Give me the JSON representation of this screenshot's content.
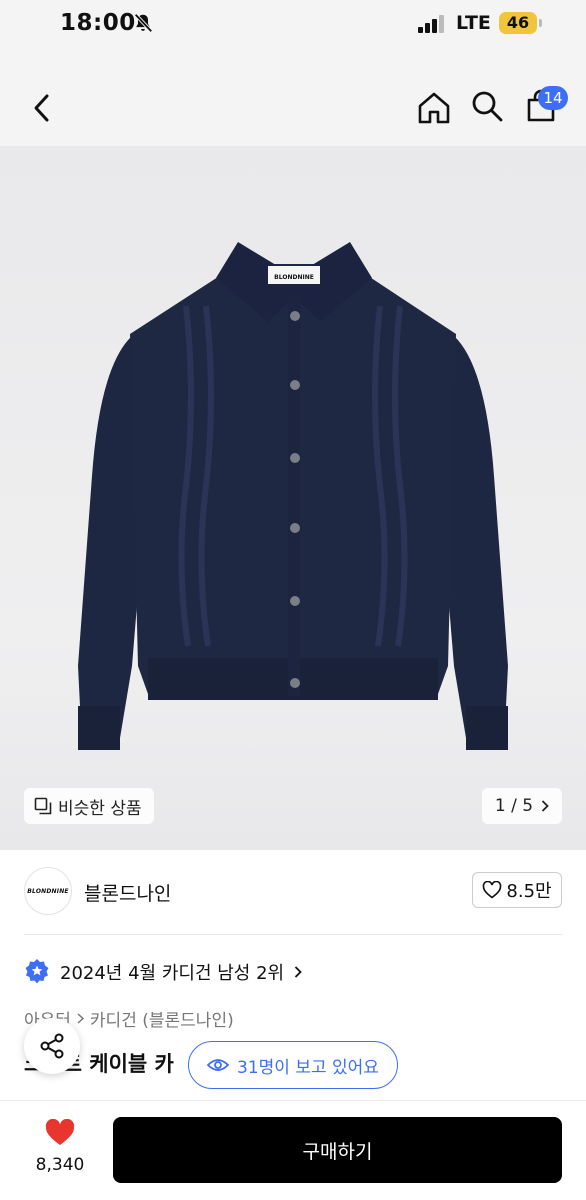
{
  "status_bar": {
    "time": "18:00",
    "network": "LTE",
    "battery": "46"
  },
  "header": {
    "cart_count": "14"
  },
  "hero": {
    "label_text": "BLONDNINE",
    "similar_label": "비슷한 상품",
    "pager": "1 / 5"
  },
  "brand": {
    "logo_text": "BLONDNINE",
    "name": "블론드나인",
    "likes": "8.5만"
  },
  "ranking": {
    "text": "2024년 4월 카디건 남성 2위"
  },
  "category": {
    "parent": "아우터",
    "child": "카디건 (블론드나인)"
  },
  "product": {
    "title_partial": "크로트 케이블 카"
  },
  "viewers": {
    "text": "31명이 보고 있어요"
  },
  "bottom": {
    "wish_count": "8,340",
    "buy_label": "구매하기"
  },
  "colors": {
    "accent": "#3d6ff5",
    "heart": "#e8352e",
    "garment": "#1d2640"
  }
}
